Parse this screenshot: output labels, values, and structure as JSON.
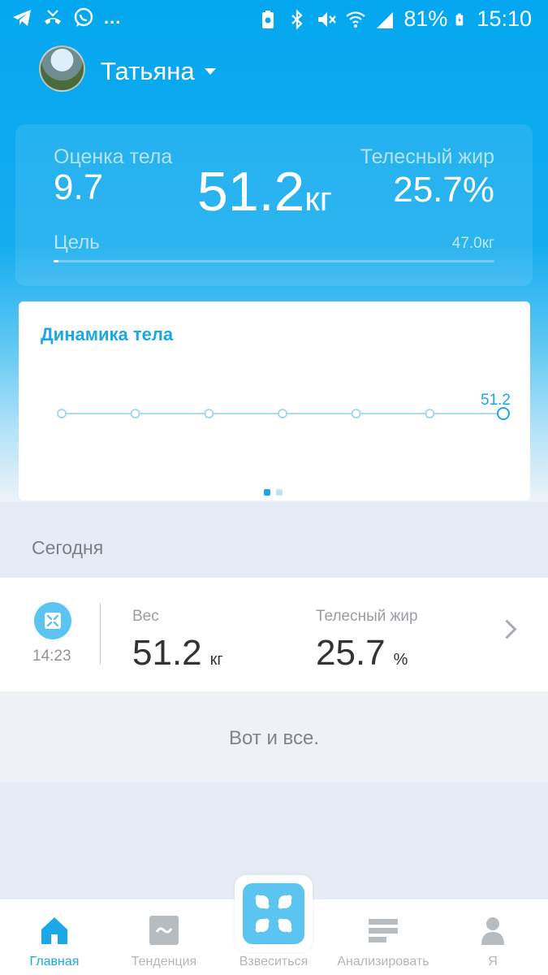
{
  "status_bar": {
    "dots": "...",
    "battery": "81%",
    "time": "15:10"
  },
  "profile": {
    "name": "Татьяна"
  },
  "summary": {
    "body_score_label": "Оценка тела",
    "body_score_value": "9.7",
    "weight_value": "51.2",
    "weight_unit": "кг",
    "fat_label": "Телесный жир",
    "fat_value": "25.7%",
    "goal_label": "Цель",
    "goal_value": "47.0кг",
    "goal_progress": 0.01
  },
  "dynamics": {
    "title": "Динамика тела",
    "pages": 2,
    "active_page": 1
  },
  "chart_data": {
    "type": "line",
    "points": 7,
    "values": [
      null,
      null,
      null,
      null,
      null,
      null,
      51.2
    ],
    "labels": [
      "",
      "",
      "",
      "",
      "",
      "",
      "51.2"
    ]
  },
  "today": {
    "section_label": "Сегодня",
    "record": {
      "time": "14:23",
      "weight_label": "Вес",
      "weight_value": "51.2",
      "weight_unit": "кг",
      "fat_label": "Телесный жир",
      "fat_value": "25.7",
      "fat_unit": "%"
    },
    "end_text": "Вот и все."
  },
  "tabs": [
    {
      "label": "Главная",
      "icon": "home-icon",
      "active": true
    },
    {
      "label": "Тенденция",
      "icon": "trend-icon",
      "active": false
    },
    {
      "label": "Взвеситься",
      "icon": "scale-icon",
      "active": false
    },
    {
      "label": "Анализировать",
      "icon": "analyze-icon",
      "active": false
    },
    {
      "label": "Я",
      "icon": "profile-icon",
      "active": false
    }
  ],
  "colors": {
    "brand_blue": "#04a7ef",
    "accent_blue": "#1ba7e8",
    "scale_blue": "#5bc4f0"
  }
}
